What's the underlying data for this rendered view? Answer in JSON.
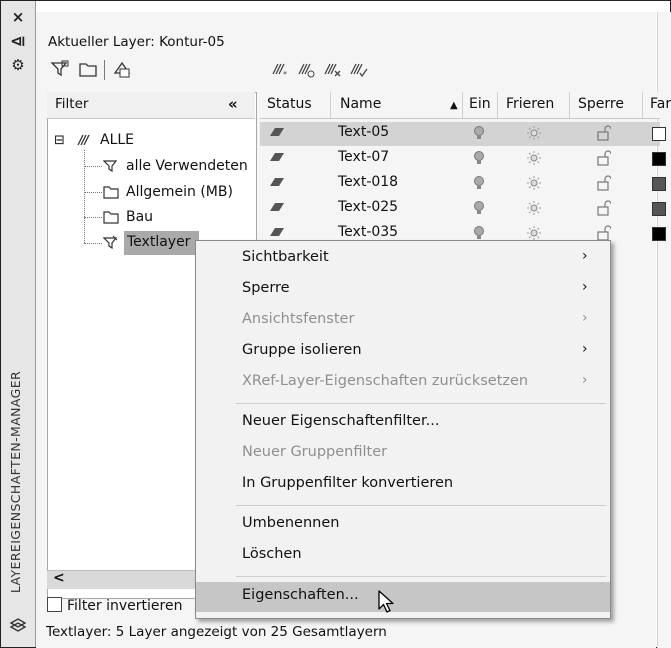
{
  "palette": {
    "vertical_title": "LAYEREIGENSCHAFTEN-MANAGER",
    "current_layer": "Aktueller Layer: Kontur-05",
    "filter_header": "Filter",
    "collapse_glyph": "«",
    "filter_invert_label": "Filter invertieren",
    "scroll_left_glyph": "<",
    "status_text": "Textlayer: 5 Layer angezeigt von 25 Gesamtlayern",
    "strip_buttons": [
      "×",
      "⧏",
      "⚙"
    ]
  },
  "filter_tree": {
    "root": "ALLE",
    "root_toggle": "⊟",
    "items": [
      "alle Verwendeten",
      "Allgemein (MB)",
      "Bau",
      "Textlayer"
    ]
  },
  "table": {
    "columns": [
      "Status",
      "Name",
      "Ein",
      "Frieren",
      "Sperre",
      "Far"
    ],
    "sort_glyph": "▲",
    "rows": [
      {
        "name": "Text-05",
        "color": "#ffffff"
      },
      {
        "name": "Text-07",
        "color": "#000000"
      },
      {
        "name": "Text-018",
        "color": "#555555"
      },
      {
        "name": "Text-025",
        "color": "#555555"
      },
      {
        "name": "Text-035",
        "color": "#000000"
      }
    ]
  },
  "context_menu": {
    "items": [
      {
        "label": "Sichtbarkeit",
        "arrow": "›"
      },
      {
        "label": "Sperre",
        "arrow": "›"
      },
      {
        "label": "Ansichtsfenster",
        "arrow": "›"
      },
      {
        "label": "Gruppe isolieren",
        "arrow": "›"
      },
      {
        "label": "XRef-Layer-Eigenschaften zurücksetzen",
        "arrow": "›"
      },
      {
        "label": "Neuer Eigenschaftenfilter..."
      },
      {
        "label": "Neuer Gruppenfilter"
      },
      {
        "label": "In Gruppenfilter konvertieren"
      },
      {
        "label": "Umbenennen"
      },
      {
        "label": "Löschen"
      },
      {
        "label": "Eigenschaften..."
      }
    ]
  },
  "icons": {
    "strip_close": "close-icon",
    "strip_pin": "pin-icon",
    "strip_settings": "settings-icon",
    "new_property_filter": "new-property-filter-icon",
    "new_group_filter": "new-group-filter-icon",
    "layer_states": "layer-states-manager-icon",
    "new_layer": "new-layer-icon",
    "new_layer_vp_frozen": "new-layer-vp-frozen-icon",
    "delete_layer": "delete-layer-icon",
    "set_current": "set-current-icon",
    "status_layer": "layer-status-icon",
    "on": "lightbulb-icon",
    "freeze": "sun-icon",
    "lock": "unlocked-padlock-icon"
  }
}
